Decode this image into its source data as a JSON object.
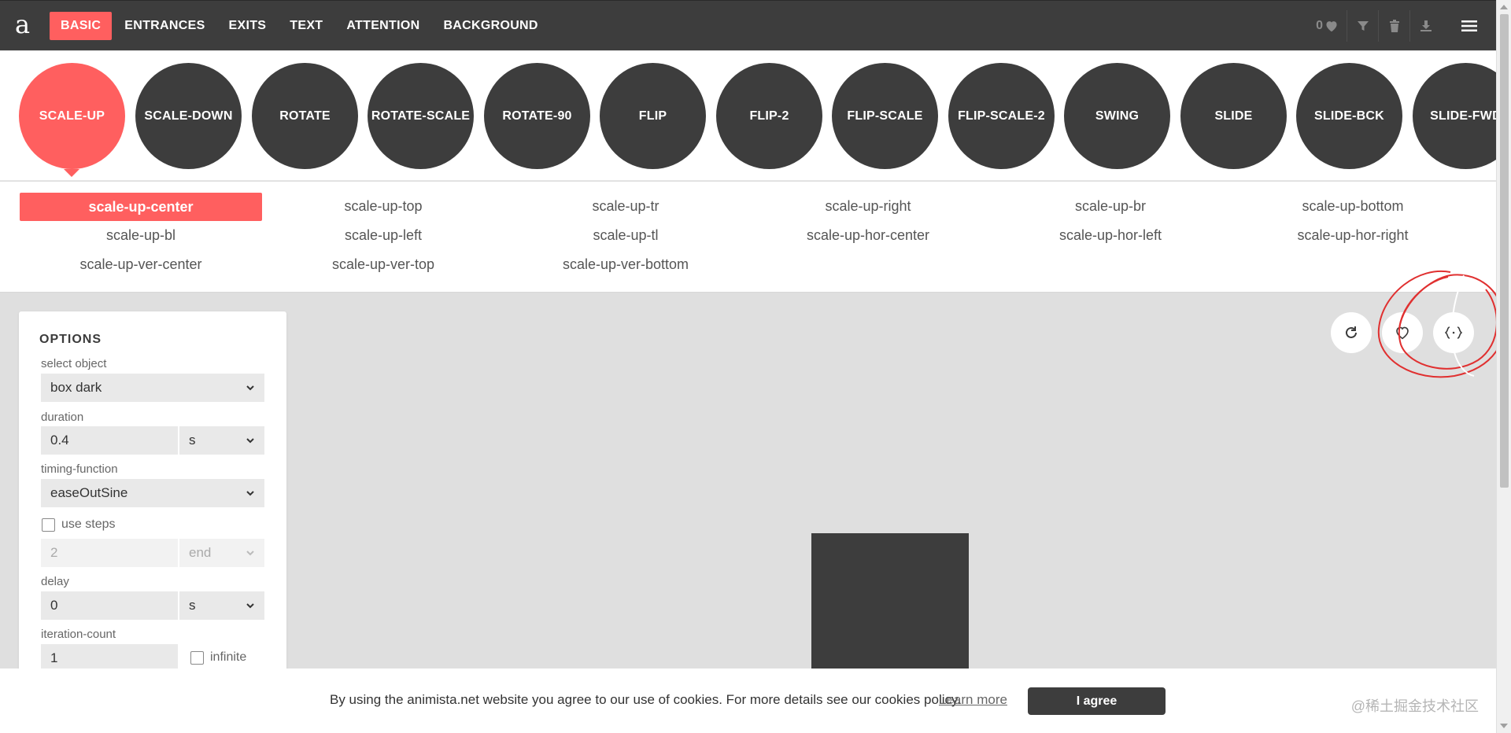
{
  "header": {
    "logo": "a",
    "nav": [
      "BASIC",
      "ENTRANCES",
      "EXITS",
      "TEXT",
      "ATTENTION",
      "BACKGROUND"
    ],
    "active_nav": "BASIC",
    "favorites_count": "0"
  },
  "categories": [
    "SCALE-UP",
    "SCALE-DOWN",
    "ROTATE",
    "ROTATE-SCALE",
    "ROTATE-90",
    "FLIP",
    "FLIP-2",
    "FLIP-SCALE",
    "FLIP-SCALE-2",
    "SWING",
    "SLIDE",
    "SLIDE-BCK",
    "SLIDE-FWD"
  ],
  "active_category": "SCALE-UP",
  "animations": [
    "scale-up-center",
    "scale-up-top",
    "scale-up-tr",
    "scale-up-right",
    "scale-up-br",
    "scale-up-bottom",
    "scale-up-bl",
    "scale-up-left",
    "scale-up-tl",
    "scale-up-hor-center",
    "scale-up-hor-left",
    "scale-up-hor-right",
    "scale-up-ver-center",
    "scale-up-ver-top",
    "scale-up-ver-bottom"
  ],
  "active_animation": "scale-up-center",
  "options": {
    "title": "OPTIONS",
    "select_object_label": "select object",
    "select_object_value": "box dark",
    "duration_label": "duration",
    "duration_value": "0.4",
    "duration_unit": "s",
    "timing_label": "timing-function",
    "timing_value": "easeOutSine",
    "use_steps_label": "use steps",
    "use_steps_checked": false,
    "steps_value": "2",
    "steps_position": "end",
    "delay_label": "delay",
    "delay_value": "0",
    "delay_unit": "s",
    "iteration_label": "iteration-count",
    "iteration_value": "1",
    "infinite_label": "infinite",
    "infinite_checked": false
  },
  "preview_actions": [
    "refresh-icon",
    "heart-icon",
    "code-icon"
  ],
  "cookie": {
    "text": "By using the animista.net website you agree to our use of cookies. For more details see our cookies policy.",
    "learn_more": "Learn more",
    "agree": "I agree"
  },
  "watermark": "@稀土掘金技术社区",
  "colors": {
    "accent": "#ff5f5f",
    "dark": "#3d3d3d",
    "canvas": "#dfdfdf"
  }
}
